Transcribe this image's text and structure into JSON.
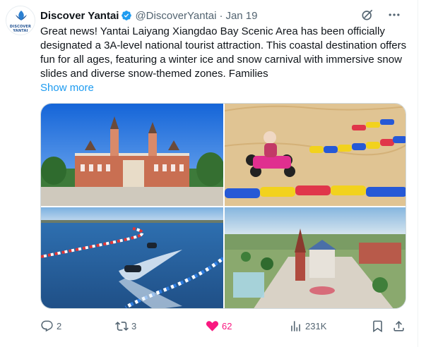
{
  "tweet": {
    "author_name": "Discover Yantai",
    "avatar_text": "DISCOVER YANTAI",
    "handle": "@DiscoverYantai",
    "separator": "·",
    "date": "Jan 19",
    "text": "Great news! Yantai Laiyang Xiangdao Bay Scenic Area has been officially designated a 3A-level national tourist attraction. This coastal destination offers fun for all ages, featuring a winter ice and snow carnival with immersive snow slides and diverse snow-themed zones. Families",
    "show_more": "Show more",
    "verified_color": "#1d9bf0"
  },
  "icons": {
    "verified": "verified-badge-icon",
    "grok": "grok-icon",
    "more": "more-icon",
    "reply": "reply-icon",
    "retweet": "retweet-icon",
    "like": "heart-icon",
    "views": "views-icon",
    "bookmark": "bookmark-icon",
    "share": "share-icon"
  },
  "stats": {
    "replies": "2",
    "retweets": "3",
    "likes": "62",
    "views": "231K"
  },
  "colors": {
    "accent": "#1d9bf0",
    "like": "#f91880",
    "text": "#0f1419",
    "secondary": "#536471"
  }
}
